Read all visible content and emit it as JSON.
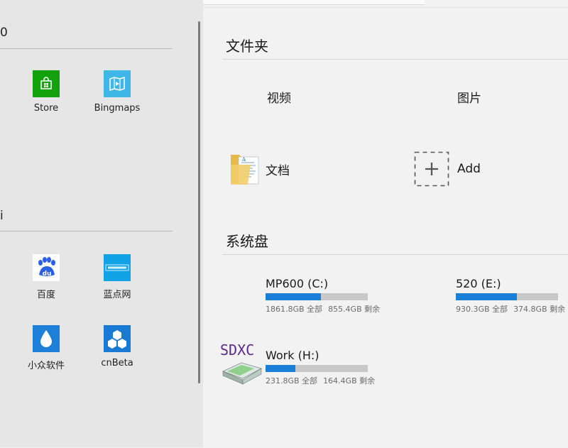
{
  "left_panel": {
    "groups": [
      {
        "header": "0",
        "apps": [
          {
            "label": "Store",
            "icon": "store-icon",
            "color": "#13a10e"
          },
          {
            "label": "Bingmaps",
            "icon": "bingmaps-icon",
            "color": "#3fb7e6"
          }
        ]
      },
      {
        "header": "i",
        "apps": [
          {
            "label": "百度",
            "icon": "baidu-icon",
            "color": "#2a5fe6"
          },
          {
            "label": "蓝点网",
            "icon": "landian-icon",
            "color": "#11a3e6"
          },
          {
            "label": "小众软件",
            "icon": "appinn-icon",
            "color": "#1e7fd9"
          },
          {
            "label": "cnBeta",
            "icon": "cnbeta-icon",
            "color": "#1979d3"
          }
        ]
      }
    ]
  },
  "right_panel": {
    "folders_section": {
      "title": "文件夹",
      "items": [
        {
          "label": "视频",
          "icon": ""
        },
        {
          "label": "图片",
          "icon": ""
        },
        {
          "label": "文档",
          "icon": "documents-folder-icon"
        },
        {
          "label": "Add",
          "icon": "add-icon"
        }
      ]
    },
    "drives_section": {
      "title": "系统盘",
      "drives": [
        {
          "name": "MP600 (C:)",
          "total": "1861.8GB 全部",
          "free": "855.4GB 剩余",
          "used_fraction": 0.54,
          "icon": ""
        },
        {
          "name": "520 (E:)",
          "total": "930.3GB 全部",
          "free": "374.8GB 剩余",
          "used_fraction": 0.6,
          "icon": ""
        },
        {
          "name": "Work (H:)",
          "total": "231.8GB 全部",
          "free": "164.4GB 剩余",
          "used_fraction": 0.29,
          "icon": "sdxc-card-icon",
          "icon_text": "SDXC"
        }
      ]
    }
  },
  "colors": {
    "accent": "#1a7fd6",
    "bar_track": "#c8c8c8"
  }
}
